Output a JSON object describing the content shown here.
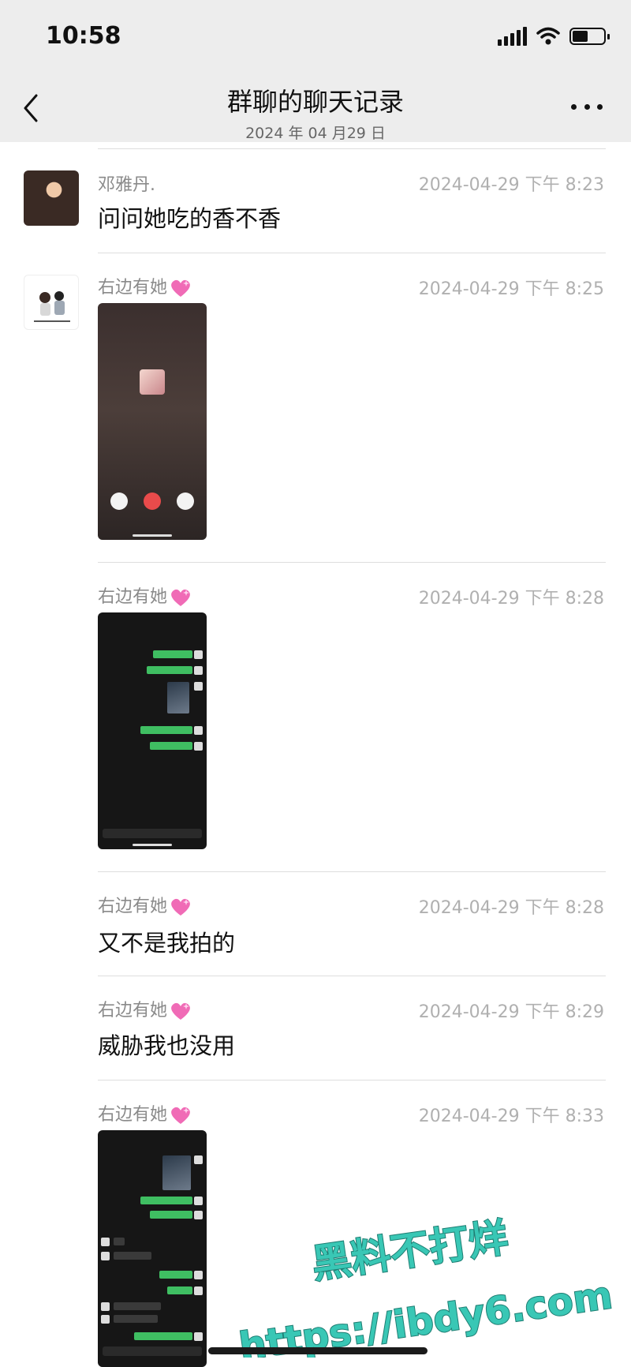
{
  "status_bar": {
    "time": "10:58"
  },
  "header": {
    "title": "群聊的聊天记录",
    "subtitle": "2024 年 04 月29 日"
  },
  "messages": [
    {
      "sender": "邓雅丹.",
      "timestamp": "2024-04-29 下午 8:23",
      "text": "问问她吃的香不香"
    },
    {
      "sender": "右边有她",
      "timestamp": "2024-04-29 下午 8:25",
      "type": "image"
    },
    {
      "sender": "右边有她",
      "timestamp": "2024-04-29 下午 8:28",
      "type": "image"
    },
    {
      "sender": "右边有她",
      "timestamp": "2024-04-29 下午 8:28",
      "text": "又不是我拍的"
    },
    {
      "sender": "右边有她",
      "timestamp": "2024-04-29 下午 8:29",
      "text": "威胁我也没用"
    },
    {
      "sender": "右边有她",
      "timestamp": "2024-04-29 下午 8:33",
      "type": "image"
    }
  ],
  "watermark": {
    "line1": "黑料不打烊",
    "line2": "https://ibdy6.com",
    "color": "#39c7b5"
  },
  "colors": {
    "nav_bg": "#ededed",
    "bubble_green": "#3fbe62",
    "timestamp": "#b0b0b0"
  }
}
